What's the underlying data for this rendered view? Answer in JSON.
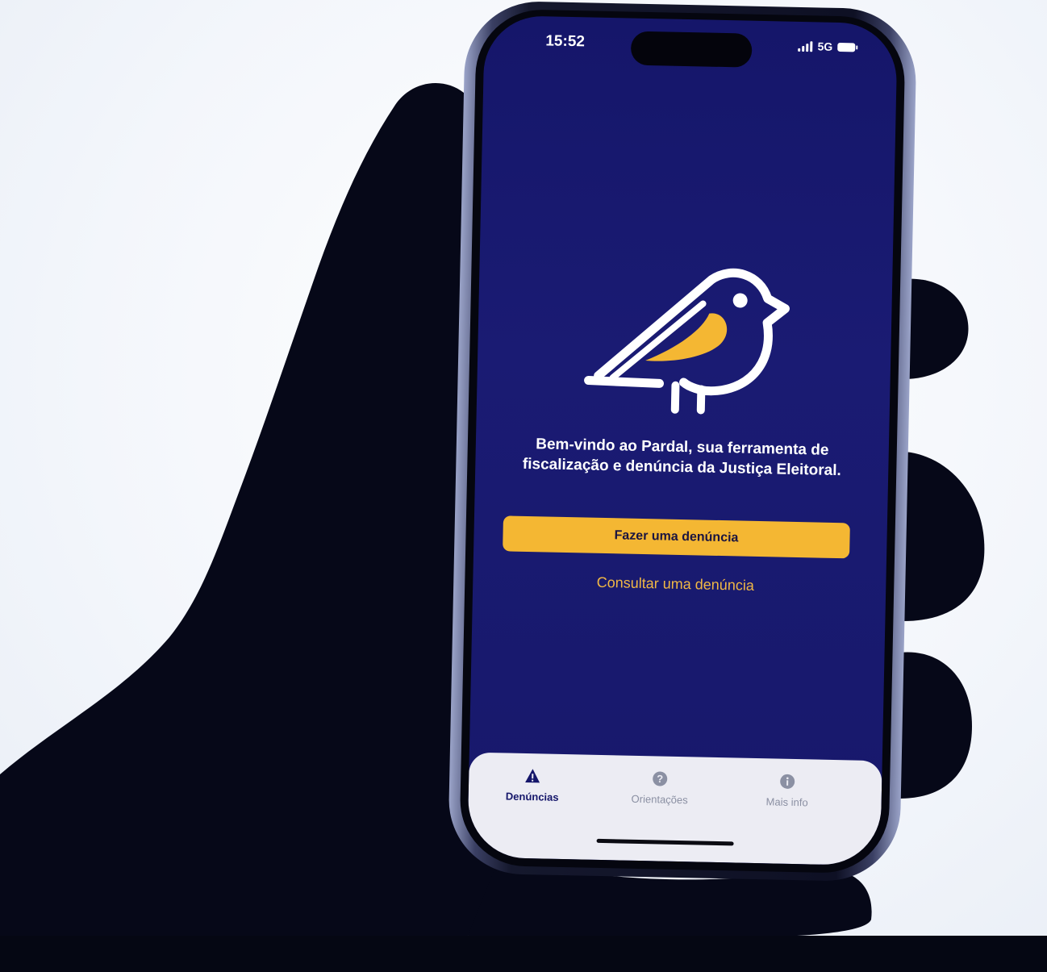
{
  "status_bar": {
    "time": "15:52",
    "network": "5G"
  },
  "welcome_text": "Bem-vindo ao Pardal, sua ferramenta de fiscalização e denúncia da Justiça Eleitoral.",
  "actions": {
    "primary_label": "Fazer uma denúncia",
    "secondary_label": "Consultar uma denúncia"
  },
  "tabs": [
    {
      "label": "Denúncias",
      "icon": "warning-icon",
      "active": true
    },
    {
      "label": "Orientações",
      "icon": "help-icon",
      "active": false
    },
    {
      "label": "Mais info",
      "icon": "info-icon",
      "active": false
    }
  ],
  "colors": {
    "screen_bg": "#17186d",
    "accent_yellow": "#f4b733",
    "link_yellow": "#f1b845",
    "tabbar_bg": "#ececf3",
    "active_tab": "#15166a",
    "inactive_tab": "#8b90a3"
  },
  "logo_icon": "sparrow-logo-icon"
}
